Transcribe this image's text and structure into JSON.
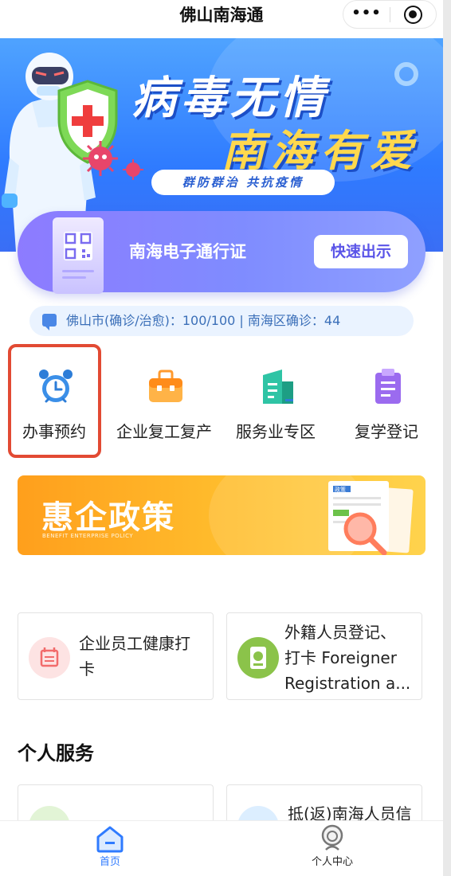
{
  "navbar": {
    "title": "佛山南海通",
    "more_label": "•••"
  },
  "banner": {
    "title_line1": "病毒无情",
    "title_line2": "南海有爱",
    "slogan": "群防群治 共抗疫情"
  },
  "pass_card": {
    "title": "南海电子通行证",
    "button_label": "快速出示"
  },
  "stats": {
    "text": "佛山市(确诊/治愈)：100/100  |  南海区确诊：44"
  },
  "quick_services": [
    {
      "label": "办事预约",
      "icon": "alarm-clock-icon",
      "highlighted": true
    },
    {
      "label": "企业复工复产",
      "icon": "briefcase-icon"
    },
    {
      "label": "服务业专区",
      "icon": "building-icon"
    },
    {
      "label": "复学登记",
      "icon": "clipboard-icon"
    }
  ],
  "policy_banner": {
    "title": "惠企政策",
    "subtitle": "BENEFIT ENTERPRISE POLICY",
    "doc_tag": "政策"
  },
  "service_cards": [
    {
      "label_line1": "企业员工健康打",
      "label_line2": "卡",
      "icon": "calendar-icon",
      "icon_color": "#f26b6b",
      "icon_bg": "#fde3e3"
    },
    {
      "label_line1": "外籍人员登记、",
      "label_line2": "打卡 Foreigner",
      "label_line3": "Registration a...",
      "icon": "passport-icon",
      "icon_color": "#ffffff",
      "icon_bg": "#8bc34a"
    }
  ],
  "personal_section": {
    "title": "个人服务",
    "partial_card_label": "抵(返)南海人员信"
  },
  "tabbar": {
    "items": [
      {
        "label": "首页",
        "icon": "home-icon",
        "active": true
      },
      {
        "label": "个人中心",
        "icon": "user-icon",
        "active": false
      }
    ]
  },
  "colors": {
    "accent_blue": "#2f7bff",
    "pass_purple": "#8d7bff",
    "policy_orange": "#ffb020",
    "highlight_red": "#e24a33"
  }
}
